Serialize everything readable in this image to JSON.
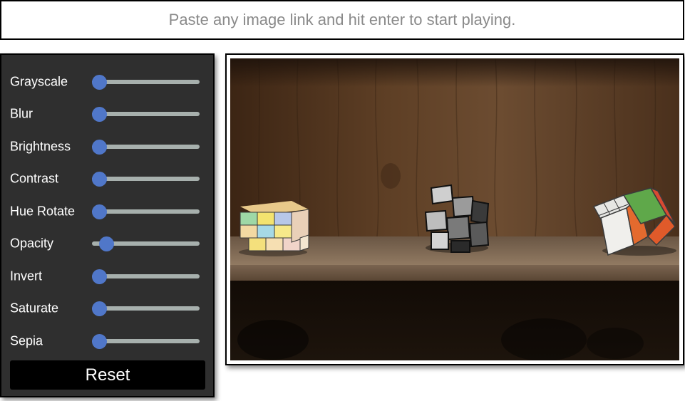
{
  "url_bar": {
    "placeholder": "Paste any image link and hit enter to start playing.",
    "value": ""
  },
  "filters": [
    {
      "id": "grayscale",
      "label": "Grayscale",
      "value": 0
    },
    {
      "id": "blur",
      "label": "Blur",
      "value": 0
    },
    {
      "id": "brightness",
      "label": "Brightness",
      "value": 0
    },
    {
      "id": "contrast",
      "label": "Contrast",
      "value": 0
    },
    {
      "id": "hue-rotate",
      "label": "Hue Rotate",
      "value": 0
    },
    {
      "id": "opacity",
      "label": "Opacity",
      "value": 0.08
    },
    {
      "id": "invert",
      "label": "Invert",
      "value": 0
    },
    {
      "id": "saturate",
      "label": "Saturate",
      "value": 0
    },
    {
      "id": "sepia",
      "label": "Sepia",
      "value": 0
    }
  ],
  "reset_label": "Reset",
  "colors": {
    "panel_bg": "#2f2f2f",
    "slider_track": "#a7b0ad",
    "slider_thumb": "#5077c9",
    "button_bg": "#000000"
  },
  "preview": {
    "subject": "photo-of-rubiks-cubes-on-wooden-shelf"
  }
}
